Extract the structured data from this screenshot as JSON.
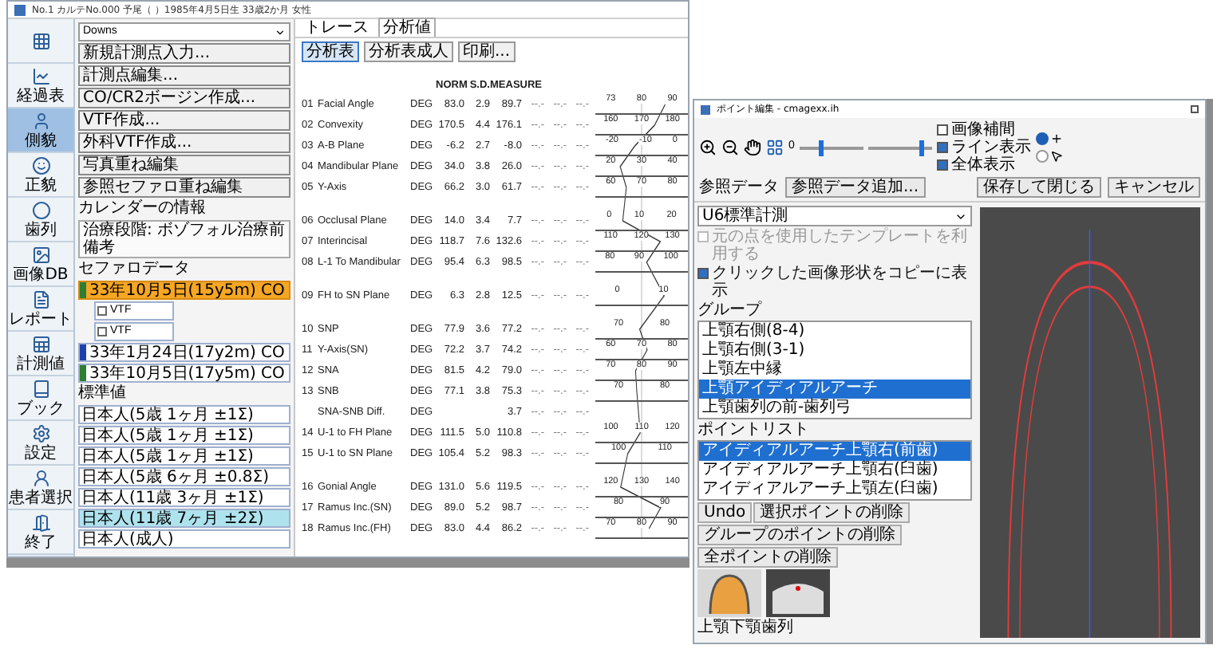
{
  "left_window": {
    "title": "No.1 カルテNo.000 予尾（ ）1985年4月5日生 33歳2か月 女性",
    "sidebar": [
      {
        "kind": "grid",
        "selected": false
      },
      {
        "kind": "chart",
        "label": "経過表",
        "selected": false
      },
      {
        "kind": "profile",
        "label": "側貌",
        "selected": true
      },
      {
        "kind": "face",
        "label": "正貌",
        "selected": false
      },
      {
        "kind": "arch",
        "label": "歯列",
        "selected": false
      },
      {
        "kind": "image",
        "label": "画像DB",
        "selected": false
      },
      {
        "kind": "report",
        "label": "レポート",
        "selected": false
      },
      {
        "kind": "sheet",
        "label": "計測値",
        "selected": false
      },
      {
        "kind": "book",
        "label": "ブック",
        "selected": false
      },
      {
        "kind": "settings",
        "label": "設定",
        "selected": false
      },
      {
        "kind": "patient",
        "label": "患者選択",
        "selected": false
      },
      {
        "kind": "exit",
        "label": "終了",
        "selected": false
      }
    ],
    "panel": {
      "template": "Downs",
      "buttons": [
        "新規計測点入力...",
        "計測点編集...",
        "CO/CR2ボージン作成...",
        "VTF作成...",
        "外科VTF作成...",
        "写真重ね編集",
        "参照セファロ重ね編集"
      ],
      "calendar_label": "カレンダーの情報",
      "calendar_lines": [
        "治療段階: ボゾフォル治療前",
        "備考"
      ],
      "cephalo_label": "セファロデータ",
      "cephalo_tree": [
        {
          "label": "33年10月5日(15y5m) CO",
          "selected": true,
          "color": "#2e7d32",
          "children": [
            {
              "label": "VTF",
              "selected": false
            },
            {
              "label": "VTF",
              "selected": false
            }
          ]
        },
        {
          "label": "33年1月24日(17y2m) CO",
          "selected": false,
          "color": "#1e40af"
        },
        {
          "label": "33年10月5日(17y5m) CO",
          "selected": false,
          "color": "#2e7d32"
        }
      ],
      "standards_label": "標準値",
      "standards": [
        {
          "label": "日本人(5歳 1ヶ月 ±1Σ)",
          "selected": false
        },
        {
          "label": "日本人(5歳 1ヶ月 ±1Σ)",
          "selected": false
        },
        {
          "label": "日本人(5歳 1ヶ月 ±1Σ)",
          "selected": false
        },
        {
          "label": "日本人(5歳 6ヶ月 ±0.8Σ)",
          "selected": false
        },
        {
          "label": "日本人(11歳 3ヶ月 ±1Σ)",
          "selected": false
        },
        {
          "label": "日本人(11歳 7ヶ月 ±2Σ)",
          "selected": true
        },
        {
          "label": "日本人(成人)",
          "selected": false
        }
      ]
    },
    "tabs": [
      {
        "label": "トレース",
        "selected": false
      },
      {
        "label": "分析値",
        "selected": true
      }
    ],
    "view_buttons": [
      {
        "label": "分析表",
        "selected": true
      },
      {
        "label": "分析表成人",
        "selected": false
      },
      {
        "label": "印刷...",
        "selected": false
      }
    ],
    "table": {
      "columns": [
        "NORM",
        "S.D.",
        "MEASURE"
      ],
      "groups": [
        {
          "rows": [
            {
              "num": "01",
              "name": "Facial Angle",
              "unit": "DEG",
              "norm": "83.0",
              "sd": "2.9",
              "measure": "89.7",
              "extra": [
                "--.-",
                "--.-",
                "--.-"
              ],
              "scale": [
                "73",
                "80",
                "90"
              ]
            },
            {
              "num": "02",
              "name": "Convexity",
              "unit": "DEG",
              "norm": "170.5",
              "sd": "4.4",
              "measure": "176.1",
              "extra": [
                "--.-",
                "--.-",
                "--.-"
              ],
              "scale": [
                "160",
                "170",
                "180"
              ]
            },
            {
              "num": "03",
              "name": "A-B Plane",
              "unit": "DEG",
              "norm": "-6.2",
              "sd": "2.7",
              "measure": "-8.0",
              "extra": [
                "--.-",
                "--.-",
                "--.-"
              ],
              "scale": [
                "-20",
                "-10",
                "0"
              ]
            },
            {
              "num": "04",
              "name": "Mandibular Plane",
              "unit": "DEG",
              "norm": "34.0",
              "sd": "3.8",
              "measure": "26.0",
              "extra": [
                "--.-",
                "--.-",
                "--.-"
              ],
              "scale": [
                "20",
                "30",
                "40"
              ]
            },
            {
              "num": "05",
              "name": "Y-Axis",
              "unit": "DEG",
              "norm": "66.2",
              "sd": "3.0",
              "measure": "61.7",
              "extra": [
                "--.-",
                "--.-",
                "--.-"
              ],
              "scale": [
                "60",
                "70",
                "80"
              ]
            }
          ]
        },
        {
          "rows": [
            {
              "num": "06",
              "name": "Occlusal Plane",
              "unit": "DEG",
              "norm": "14.0",
              "sd": "3.4",
              "measure": "7.7",
              "extra": [
                "--.-",
                "--.-",
                "--.-"
              ],
              "scale": [
                "0",
                "10",
                "20"
              ]
            },
            {
              "num": "07",
              "name": "Interincisal",
              "unit": "DEG",
              "norm": "118.7",
              "sd": "7.6",
              "measure": "132.6",
              "extra": [
                "--.-",
                "--.-",
                "--.-"
              ],
              "scale": [
                "110",
                "120",
                "130"
              ]
            },
            {
              "num": "08",
              "name": "L-1 To Mandibular",
              "unit": "DEG",
              "norm": "95.4",
              "sd": "6.3",
              "measure": "98.5",
              "extra": [
                "--.-",
                "--.-",
                "--.-"
              ],
              "scale": [
                "80",
                "90",
                "100"
              ]
            }
          ]
        },
        {
          "rows": [
            {
              "num": "09",
              "name": "FH to SN Plane",
              "unit": "DEG",
              "norm": "6.3",
              "sd": "2.8",
              "measure": "12.5",
              "extra": [
                "--.-",
                "--.-",
                "--.-"
              ],
              "scale": [
                "0",
                "10"
              ]
            }
          ]
        },
        {
          "rows": [
            {
              "num": "10",
              "name": "SNP",
              "unit": "DEG",
              "norm": "77.9",
              "sd": "3.6",
              "measure": "77.2",
              "extra": [
                "--.-",
                "--.-",
                "--.-"
              ],
              "scale": [
                "70",
                "80"
              ]
            },
            {
              "num": "11",
              "name": "Y-Axis(SN)",
              "unit": "DEG",
              "norm": "72.2",
              "sd": "3.7",
              "measure": "74.2",
              "extra": [
                "--.-",
                "--.-",
                "--.-"
              ],
              "scale": [
                "60",
                "70",
                "80"
              ]
            },
            {
              "num": "12",
              "name": "SNA",
              "unit": "DEG",
              "norm": "81.5",
              "sd": "4.2",
              "measure": "79.0",
              "extra": [
                "--.-",
                "--.-",
                "--.-"
              ],
              "scale": [
                "70",
                "80",
                "90"
              ]
            },
            {
              "num": "13",
              "name": "SNB",
              "unit": "DEG",
              "norm": "77.1",
              "sd": "3.8",
              "measure": "75.3",
              "extra": [
                "--.-",
                "--.-",
                "--.-"
              ],
              "scale": [
                "70",
                "80"
              ]
            },
            {
              "name": "SNA-SNB Diff.",
              "unit": "DEG",
              "measure": "3.7",
              "extra": [
                "--.-",
                "--.-",
                "--.-"
              ]
            },
            {
              "num": "14",
              "name": "U-1 to FH Plane",
              "unit": "DEG",
              "norm": "111.5",
              "sd": "5.0",
              "measure": "110.8",
              "extra": [
                "--.-",
                "--.-",
                "--.-"
              ],
              "scale": [
                "100",
                "110",
                "120"
              ]
            },
            {
              "num": "15",
              "name": "U-1 to SN Plane",
              "unit": "DEG",
              "norm": "105.4",
              "sd": "5.2",
              "measure": "98.3",
              "extra": [
                "--.-",
                "--.-",
                "--.-"
              ],
              "scale": [
                "100",
                "110"
              ]
            }
          ]
        },
        {
          "rows": [
            {
              "num": "16",
              "name": "Gonial Angle",
              "unit": "DEG",
              "norm": "131.0",
              "sd": "5.6",
              "measure": "119.5",
              "extra": [
                "--.-",
                "--.-",
                "--.-"
              ],
              "scale": [
                "120",
                "130",
                "140"
              ]
            },
            {
              "num": "17",
              "name": "Ramus Inc.(SN)",
              "unit": "DEG",
              "norm": "89.0",
              "sd": "5.2",
              "measure": "98.7",
              "extra": [
                "--.-",
                "--.-",
                "--.-"
              ],
              "scale": [
                "80",
                "90"
              ]
            },
            {
              "num": "18",
              "name": "Ramus Inc.(FH)",
              "unit": "DEG",
              "norm": "83.0",
              "sd": "4.4",
              "measure": "86.2",
              "extra": [
                "--.-",
                "--.-",
                "--.-"
              ],
              "scale": [
                "70",
                "80",
                "90"
              ]
            }
          ]
        }
      ]
    }
  },
  "right_window": {
    "title": "ポイント編集 - cmagexx.ih",
    "toolbar": {
      "zero_label": "0",
      "sliders": [
        {
          "level": 0.35
        },
        {
          "level": 0.85
        }
      ],
      "checkboxes": [
        {
          "label": "画像補間",
          "checked": false
        },
        {
          "label": "ライン表示",
          "checked": true
        },
        {
          "label": "全体表示",
          "checked": true
        }
      ],
      "radios": [
        {
          "kind": "plus",
          "selected": true
        },
        {
          "kind": "cursor",
          "selected": false
        }
      ],
      "reference_label": "参照データ",
      "reference_button": "参照データ追加...",
      "buttons": [
        "保存して閉じる",
        "キャンセル"
      ]
    },
    "template": "U6標準計測",
    "options": [
      {
        "label": "元の点を使用したテンプレートを利用する",
        "checked": false,
        "disabled": true
      },
      {
        "label": "クリックした画像形状をコピーに表示",
        "checked": true,
        "disabled": false
      }
    ],
    "group_label": "グループ",
    "groups": [
      {
        "label": "上顎右側(8-4)",
        "selected": false
      },
      {
        "label": "上顎右側(3-1)",
        "selected": false
      },
      {
        "label": "上顎左中縁",
        "selected": false
      },
      {
        "label": "上顎アイディアルアーチ",
        "selected": true
      },
      {
        "label": "上顎歯列の前-歯列弓",
        "selected": false
      }
    ],
    "point_label": "ポイントリスト",
    "points": [
      {
        "label": "アイディアルアーチ上顎右(前歯)",
        "selected": true
      },
      {
        "label": "アイディアルアーチ上顎右(臼歯)",
        "selected": false
      },
      {
        "label": "アイディアルアーチ上顎左(臼歯)",
        "selected": false
      }
    ],
    "actions": [
      "Undo",
      "選択ポイントの削除",
      "グループのポイントの削除",
      "全ポイントの削除"
    ],
    "footer_label": "上顎下顎歯列"
  }
}
